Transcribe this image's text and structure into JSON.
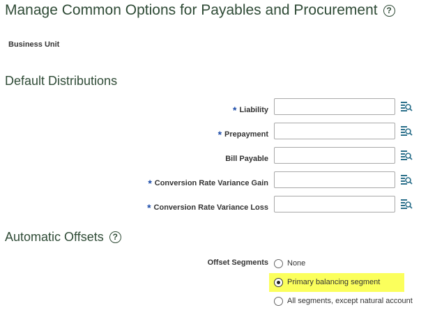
{
  "page": {
    "title": "Manage Common Options for Payables and Procurement",
    "help_icon": "help-icon"
  },
  "business_unit": {
    "label": "Business Unit"
  },
  "default_distributions": {
    "heading": "Default Distributions",
    "fields": [
      {
        "label": "Liability",
        "required": "*",
        "value": "",
        "icon": "search-icon"
      },
      {
        "label": "Prepayment",
        "required": "*",
        "value": "",
        "icon": "search-icon"
      },
      {
        "label": "Bill Payable",
        "required": "",
        "value": "",
        "icon": "search-icon"
      },
      {
        "label": "Conversion Rate Variance Gain",
        "required": "*",
        "value": "",
        "icon": "search-icon"
      },
      {
        "label": "Conversion Rate Variance Loss",
        "required": "*",
        "value": "",
        "icon": "search-icon"
      }
    ]
  },
  "automatic_offsets": {
    "heading": "Automatic Offsets",
    "help_icon": "help-icon",
    "offset_segments_label": "Offset Segments",
    "options": [
      {
        "label": "None",
        "checked": false
      },
      {
        "label": "Primary balancing segment",
        "checked": true
      },
      {
        "label": "All segments, except natural account",
        "checked": false
      }
    ],
    "highlight_color": "#fbff5c"
  },
  "colors": {
    "heading": "#2f4b36",
    "required": "#1a4aa8"
  }
}
